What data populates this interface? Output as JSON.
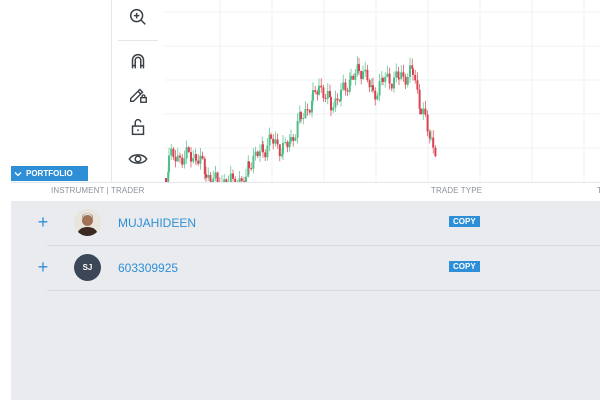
{
  "portfolio": {
    "tab_label": "PORTFOLIO"
  },
  "table": {
    "columns": [
      "INSTRUMENT | TRADER",
      "TRADE TYPE",
      "T"
    ],
    "rows": [
      {
        "name": "MUJAHIDEEN",
        "avatar_type": "photo",
        "trade_type": "COPY"
      },
      {
        "name": "603309925",
        "avatar_initials": "SJ",
        "trade_type": "COPY"
      }
    ]
  },
  "toolbar": {
    "tools": [
      "zoom-in-icon",
      "magnet-icon",
      "lock-pencil-icon",
      "unlock-icon",
      "eye-icon"
    ]
  },
  "colors": {
    "accent": "#2f8fd6",
    "up_candle": "#4fbf8a",
    "down_candle": "#d9434f"
  }
}
